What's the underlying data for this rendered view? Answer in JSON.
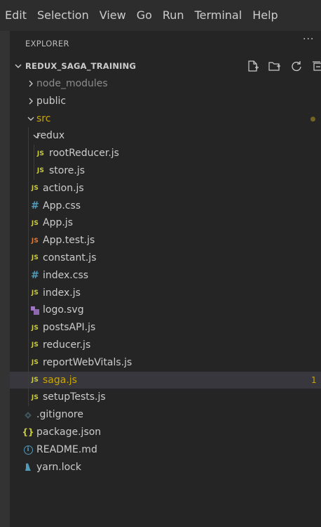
{
  "menubar": {
    "items": [
      "Edit",
      "Selection",
      "View",
      "Go",
      "Run",
      "Terminal",
      "Help"
    ]
  },
  "explorer": {
    "title": "EXPLORER",
    "more_icon": "ellipsis-icon",
    "folder": {
      "name": "REDUX_SAGA_TRAINING",
      "actions": [
        "new-file-icon",
        "new-folder-icon",
        "refresh-icon",
        "collapse-all-icon"
      ]
    }
  },
  "tree": [
    {
      "label": "node_modules",
      "type": "folder",
      "expanded": false,
      "level": 0,
      "muted": true
    },
    {
      "label": "public",
      "type": "folder",
      "expanded": false,
      "level": 0
    },
    {
      "label": "src",
      "type": "folder",
      "expanded": true,
      "level": 0,
      "modified": true
    },
    {
      "label": "redux",
      "type": "folder",
      "expanded": true,
      "level": 1
    },
    {
      "label": "rootReducer.js",
      "type": "js",
      "level": 2
    },
    {
      "label": "store.js",
      "type": "js",
      "level": 2
    },
    {
      "label": "action.js",
      "type": "js",
      "level": 1
    },
    {
      "label": "App.css",
      "type": "css",
      "level": 1
    },
    {
      "label": "App.js",
      "type": "js",
      "level": 1
    },
    {
      "label": "App.test.js",
      "type": "test",
      "level": 1
    },
    {
      "label": "constant.js",
      "type": "js",
      "level": 1
    },
    {
      "label": "index.css",
      "type": "css",
      "level": 1
    },
    {
      "label": "index.js",
      "type": "js",
      "level": 1
    },
    {
      "label": "logo.svg",
      "type": "svg",
      "level": 1
    },
    {
      "label": "postsAPI.js",
      "type": "js",
      "level": 1
    },
    {
      "label": "reducer.js",
      "type": "js",
      "level": 1
    },
    {
      "label": "reportWebVitals.js",
      "type": "js",
      "level": 1
    },
    {
      "label": "saga.js",
      "type": "js",
      "level": 1,
      "selected": true,
      "badge": "1"
    },
    {
      "label": "setupTests.js",
      "type": "js",
      "level": 1
    },
    {
      "label": ".gitignore",
      "type": "git",
      "level": 0
    },
    {
      "label": "package.json",
      "type": "json",
      "level": 0
    },
    {
      "label": "README.md",
      "type": "info",
      "level": 0
    },
    {
      "label": "yarn.lock",
      "type": "yarn",
      "level": 0
    }
  ],
  "colors": {
    "js": "#cbcb41",
    "test": "#e37933",
    "css": "#519aba",
    "svg": "#a074c4",
    "warning_text": "#cca700"
  }
}
